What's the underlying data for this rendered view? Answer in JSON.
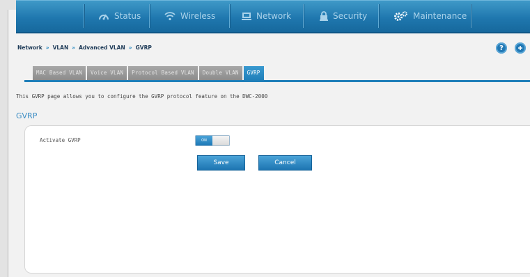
{
  "nav": {
    "items": [
      {
        "label": "Status",
        "icon": "dashboard-icon"
      },
      {
        "label": "Wireless",
        "icon": "wifi-icon"
      },
      {
        "label": "Network",
        "icon": "network-icon"
      },
      {
        "label": "Security",
        "icon": "lock-icon"
      },
      {
        "label": "Maintenance",
        "icon": "gears-icon"
      }
    ]
  },
  "breadcrumb": [
    "Network",
    "VLAN",
    "Advanced VLAN",
    "GVRP"
  ],
  "breadcrumb_sep": "»",
  "help_icons": [
    "help-icon",
    "info-icon"
  ],
  "tabs": [
    {
      "label": "MAC Based VLAN",
      "active": false
    },
    {
      "label": "Voice VLAN",
      "active": false
    },
    {
      "label": "Protocol Based VLAN",
      "active": false
    },
    {
      "label": "Double VLAN",
      "active": false
    },
    {
      "label": "GVRP",
      "active": true
    }
  ],
  "description": "This GVRP page allows you to configure the GVRP protocol feature on the DWC-2000",
  "section_title": "GVRP",
  "form": {
    "activate_label": "Activate GVRP",
    "toggle_on_label": "ON",
    "toggle_state": "on"
  },
  "buttons": {
    "save": "Save",
    "cancel": "Cancel"
  },
  "colors": {
    "accent": "#1f7fb9",
    "nav_bg": "#2a83b8",
    "tab_inactive": "#999999"
  }
}
